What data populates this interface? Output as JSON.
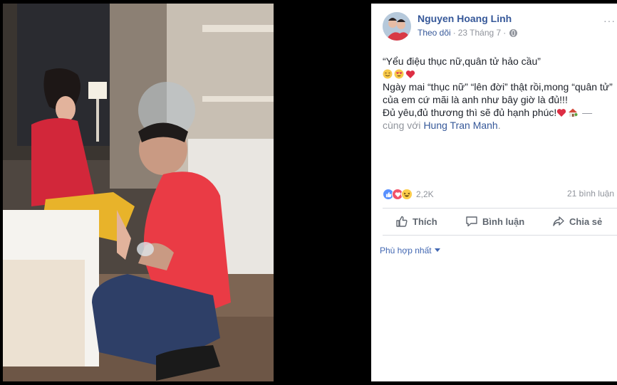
{
  "post": {
    "author": "Nguyen Hoang Linh",
    "follow_label": "Theo dõi",
    "date": "23 Tháng 7",
    "separator": "·",
    "text_line1": "“Yểu điệu thục nữ,quân tử hảo cầu”",
    "text_line3": "Ngày mai “thục nữ” “lên đời” thật rồi,mong “quân tử”",
    "text_line4": "của em cứ mãi là anh như bây giờ là đủ!!!",
    "text_line5": "Đủ yêu,đủ thương thì sẽ đủ hạnh phúc!",
    "dash": " —",
    "with_label": "cùng với ",
    "tagged_user": "Hung Tran Manh",
    "period": ".",
    "emoji_line2": [
      "smiling-face-icon",
      "heart-eyes-icon",
      "red-heart-icon"
    ],
    "emoji_line5": [
      "red-heart-icon",
      "house-icon"
    ]
  },
  "reactions": {
    "types": [
      "like",
      "love",
      "haha"
    ],
    "count": "2,2K",
    "comments": "21 bình luận"
  },
  "actions": {
    "like": "Thích",
    "comment": "Bình luận",
    "share": "Chia sẻ"
  },
  "sort": {
    "label": "Phù hợp nhất"
  },
  "colors": {
    "link": "#365899",
    "muted": "#90949c",
    "like_blue": "#5890ff",
    "love_red": "#f25268",
    "haha_yellow": "#fccd4b"
  }
}
